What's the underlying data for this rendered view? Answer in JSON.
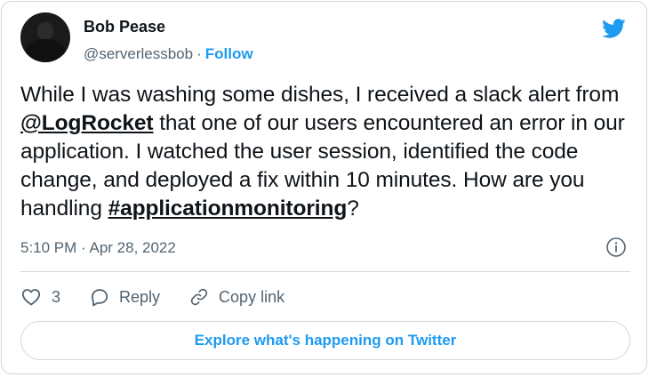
{
  "author": {
    "name": "Bob Pease",
    "handle": "@serverlessbob",
    "separator": "·",
    "follow_label": "Follow"
  },
  "tweet": {
    "text_1": "While I was washing some dishes, I received a slack alert from ",
    "mention": "@LogRocket",
    "text_2": " that one of our users encountered an error in our application. I watched the user session, identified the code change, and deployed a fix within 10 minutes. How are you handling ",
    "hashtag": "#applicationmonitoring",
    "text_3": "?",
    "timestamp": "5:10 PM · Apr 28, 2022"
  },
  "actions": {
    "like_count": "3",
    "reply_label": "Reply",
    "copy_link_label": "Copy link"
  },
  "explore_label": "Explore what's happening on Twitter",
  "icons": {
    "brand": "twitter-bird-icon",
    "info": "info-icon",
    "like": "heart-icon",
    "reply": "reply-bubble-icon",
    "copy": "link-icon"
  },
  "colors": {
    "brand_blue": "#1d9bf0",
    "secondary_text": "#536471",
    "border": "#cfd9de"
  }
}
